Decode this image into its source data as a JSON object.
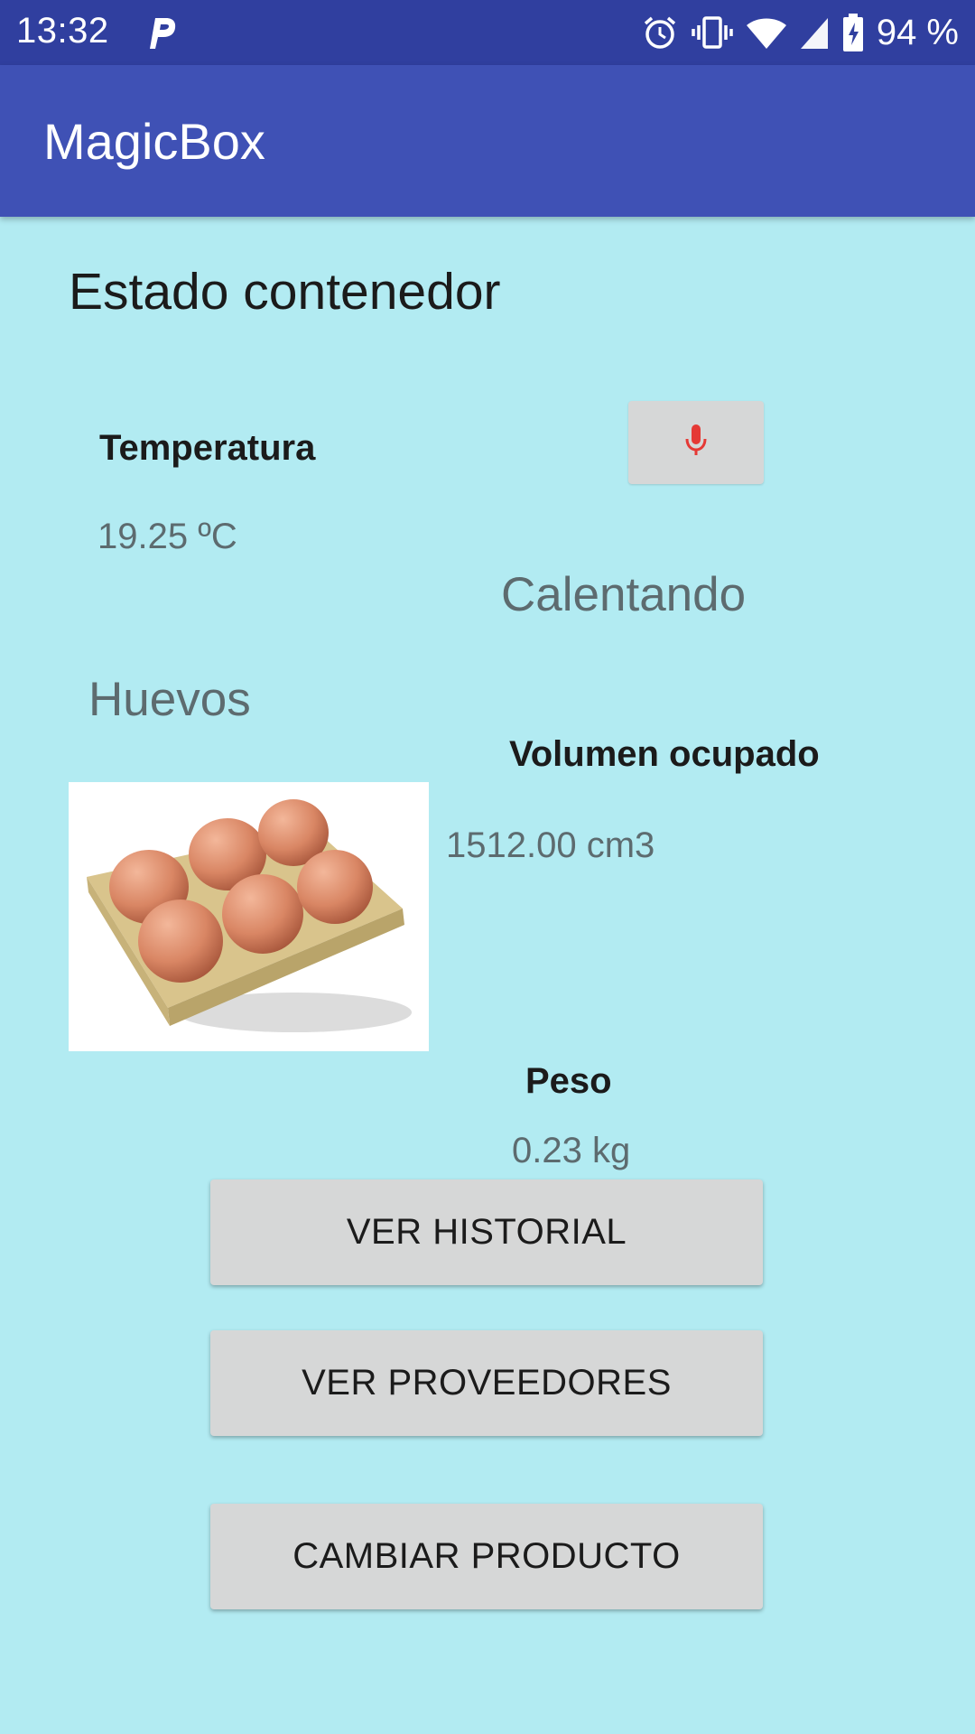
{
  "status_bar": {
    "time": "13:32",
    "battery": "94 %",
    "icons": [
      "parking-p-icon",
      "alarm-icon",
      "vibrate-icon",
      "wifi-icon",
      "signal-icon",
      "battery-charging-icon"
    ]
  },
  "app_bar": {
    "title": "MagicBox"
  },
  "main": {
    "section_title": "Estado contenedor",
    "temperature": {
      "label": "Temperatura",
      "value": "19.25 ºC"
    },
    "mic_button": {
      "icon": "microphone-icon",
      "color": "#e53935"
    },
    "heating_status": "Calentando",
    "product": {
      "name": "Huevos",
      "image": "egg-carton-image"
    },
    "volume": {
      "label": "Volumen ocupado",
      "value": "1512.00 cm3"
    },
    "weight": {
      "label": "Peso",
      "value": "0.23 kg"
    },
    "buttons": {
      "history": "VER HISTORIAL",
      "providers": "VER PROVEEDORES",
      "change_product": "CAMBIAR PRODUCTO"
    }
  },
  "colors": {
    "status_bar": "#303f9f",
    "app_bar": "#3f51b5",
    "background": "#b2ebf2",
    "button": "#d6d7d7"
  }
}
